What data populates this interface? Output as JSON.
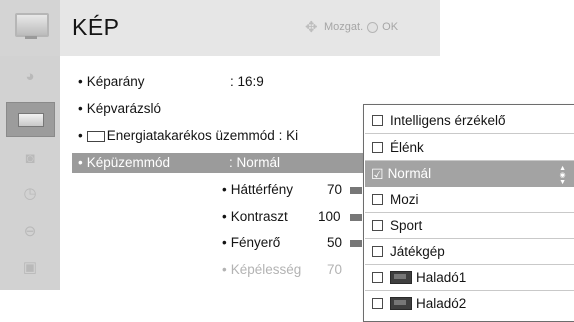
{
  "header": {
    "title": "KÉP",
    "hint_move": "Mozgat.",
    "hint_ok": "OK"
  },
  "sidebar": {
    "items": [
      {
        "icon": "palette-icon",
        "active": false
      },
      {
        "icon": "tv-picture-icon",
        "active": true
      },
      {
        "icon": "speaker-icon",
        "active": false
      },
      {
        "icon": "clock-icon",
        "active": false
      },
      {
        "icon": "lock-icon",
        "active": false
      },
      {
        "icon": "option-icon",
        "active": false
      }
    ]
  },
  "menu": {
    "aspect_label": "Képarány",
    "aspect_value": ": 16:9",
    "wizard_label": "Képvarázsló",
    "energy_label": "Energiatakarékos üzemmód : Ki",
    "mode_label": "Képüzemmód",
    "mode_value": ": Normál",
    "backlight_label": "Háttérfény",
    "backlight_value": "70",
    "contrast_label": "Kontraszt",
    "contrast_value": "100",
    "brightness_label": "Fényerő",
    "brightness_value": "50",
    "sharpness_label": "Képélesség",
    "sharpness_value": "70"
  },
  "dropdown": {
    "options": [
      {
        "label": "Intelligens érzékelő",
        "checked": false,
        "selected": false
      },
      {
        "label": "Élénk",
        "checked": false,
        "selected": false
      },
      {
        "label": "Normál",
        "checked": true,
        "selected": true
      },
      {
        "label": "Mozi",
        "checked": false,
        "selected": false
      },
      {
        "label": "Sport",
        "checked": false,
        "selected": false
      },
      {
        "label": "Játékgép",
        "checked": false,
        "selected": false
      },
      {
        "label": "Haladó1",
        "checked": false,
        "selected": false
      },
      {
        "label": "Haladó2",
        "checked": false,
        "selected": false
      }
    ]
  },
  "colors": {
    "header_bg": "#e6e6e6",
    "sidebar_bg": "#d2d2d2",
    "selected_bg": "#9b9b9b"
  }
}
